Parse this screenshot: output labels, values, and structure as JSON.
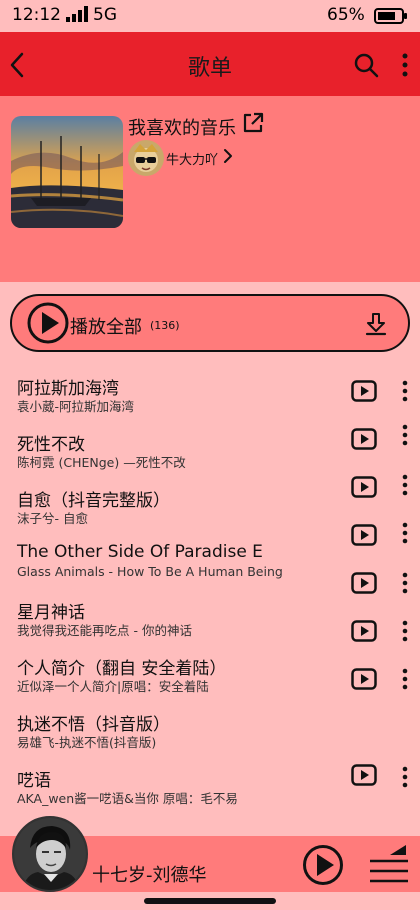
{
  "status_bar": {
    "time": "12:12",
    "network": "5G",
    "battery": "65%"
  },
  "nav": {
    "title": "歌单"
  },
  "playlist": {
    "name": "我喜欢的音乐",
    "creator": "牛大力吖"
  },
  "play_all": {
    "label": "播放全部",
    "count": "(136)"
  },
  "songs": [
    {
      "title": "阿拉斯加海湾",
      "artist": "袁小葳-阿拉斯加海湾"
    },
    {
      "title": "死性不改",
      "artist": "陈柯霓 (CHENge) —死性不改"
    },
    {
      "title": "自愈（抖音完整版）",
      "artist": "沫子兮- 自愈"
    },
    {
      "title": "The Other Side Of Paradise E",
      "artist": "Glass Animals - How To Be A Human Being"
    },
    {
      "title": "星月神话",
      "artist": "我觉得我还能再吃点 - 你的神话"
    },
    {
      "title": "个人简介（翻自 安全着陆）",
      "artist": "近似泽一个人简介|原唱：安全着陆"
    },
    {
      "title": "执迷不悟（抖音版）",
      "artist": "易雄飞-执迷不悟(抖音版)"
    },
    {
      "title": "呓语",
      "artist": "AKA_wen酱一呓语&当你 原唱：毛不易"
    }
  ],
  "mini_player": {
    "title": "十七岁-刘德华"
  },
  "colors": {
    "header_red": "#e8212b",
    "panel": "#ff7b7b",
    "background": "#ffbdbd"
  }
}
